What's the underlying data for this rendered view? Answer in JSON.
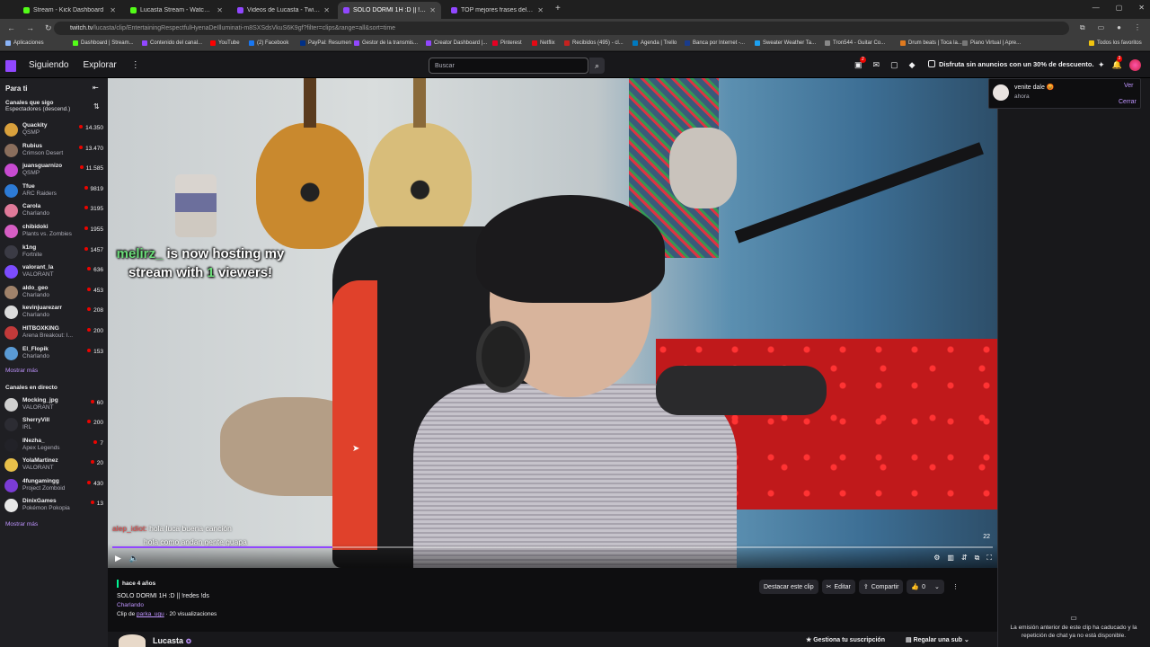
{
  "browser": {
    "tabs": [
      {
        "title": "Stream - Kick Dashboard",
        "color": "#53fc18",
        "active": false
      },
      {
        "title": "Lucasta Stream - Watch Live on",
        "color": "#53fc18",
        "active": false
      },
      {
        "title": "Videos de Lucasta - Twitch",
        "color": "#9147ff",
        "active": false
      },
      {
        "title": "SOLO DORMI 1H :D || !redes !ds",
        "color": "#9147ff",
        "active": true
      },
      {
        "title": "TOP mejores frases del anime",
        "color": "#9147ff",
        "active": false
      }
    ],
    "url_prefix": "twitch.tv",
    "url_rest": "/lucasta/clip/EntertainingRespectfulHyenaDeIlluminati-m8SXSdsVkuS6K9gf?filter=clips&range=all&sort=time",
    "bookmarks": [
      "Aplicaciones",
      "Dashboard | Stream...",
      "Contenido del canal...",
      "YouTube",
      "(2) Facebook",
      "PayPal: Resumen",
      "Gestor de la transmis...",
      "Creator Dashboard |...",
      "Pinterest",
      "Netflix",
      "Recibidos (495) - cl...",
      "Agenda | Trello",
      "Banca por Internet -...",
      "Sweater Weather Ta...",
      "Tron544 - Guitar Co...",
      "Drum beats | Toca la...",
      "Piano Virtual | Apre...",
      "Todos los favoritos"
    ]
  },
  "topnav": {
    "following": "Siguiendo",
    "explore": "Explorar",
    "search_placeholder": "Buscar",
    "notif_count": "2",
    "promo": "Disfruta sin anuncios con un 30% de descuento.",
    "bits_count": "3"
  },
  "sidebar": {
    "title": "Para ti",
    "followed_title": "Canales que sigo",
    "followed_sub": "Espectadores (descend.)",
    "followed": [
      {
        "name": "Quackity",
        "cat": "QSMP",
        "viewers": "14.350",
        "color": "#d9a03c"
      },
      {
        "name": "Rubius",
        "cat": "Crimson Desert",
        "viewers": "13.470",
        "color": "#8a6e5c"
      },
      {
        "name": "juansguarnizo",
        "cat": "QSMP",
        "viewers": "11.585",
        "color": "#c84bd1"
      },
      {
        "name": "Tfue",
        "cat": "ARC Raiders",
        "viewers": "9819",
        "color": "#2d7bd6"
      },
      {
        "name": "Carola",
        "cat": "Charlando",
        "viewers": "3195",
        "color": "#e07a9a"
      },
      {
        "name": "chibidoki",
        "cat": "Plants vs. Zombies",
        "viewers": "1955",
        "color": "#d65ec4"
      },
      {
        "name": "k1ng",
        "cat": "Fortnite",
        "viewers": "1457",
        "color": "#3b3b45"
      },
      {
        "name": "valorant_la",
        "cat": "VALORANT",
        "viewers": "636",
        "color": "#7c4cff"
      },
      {
        "name": "aldo_geo",
        "cat": "Charlando",
        "viewers": "453",
        "color": "#a0826a"
      },
      {
        "name": "kevinjuarezarr",
        "cat": "Charlando",
        "viewers": "208",
        "color": "#dcdcdc"
      },
      {
        "name": "HITBOXKING",
        "cat": "Arena Breakout: I...",
        "viewers": "200",
        "color": "#c23a3a"
      },
      {
        "name": "El_Flopik",
        "cat": "Charlando",
        "viewers": "153",
        "color": "#5a9bd6"
      }
    ],
    "more1": "Mostrar más",
    "live_title": "Canales en directo",
    "live": [
      {
        "name": "Mocking_jpg",
        "cat": "VALORANT",
        "viewers": "60",
        "color": "#d0d0d0"
      },
      {
        "name": "SherryVill",
        "cat": "IRL",
        "viewers": "200",
        "color": "#2c2c33"
      },
      {
        "name": "INezha_",
        "cat": "Apex Legends",
        "viewers": "7",
        "color": "#222228"
      },
      {
        "name": "YolaMartinez",
        "cat": "VALORANT",
        "viewers": "20",
        "color": "#e8c04a"
      },
      {
        "name": "4fungamingg",
        "cat": "Project Zomboid",
        "viewers": "430",
        "color": "#7b3cd6"
      },
      {
        "name": "DinixGames",
        "cat": "Pokémon Pokopia",
        "viewers": "13",
        "color": "#e8e8e8"
      }
    ],
    "more2": "Mostrar más"
  },
  "video": {
    "host_prefix": "melirz_",
    "host_mid": " is now hosting my stream with ",
    "host_num": "1",
    "host_end": " viewers!",
    "chat": [
      {
        "user": "alep_idiot:",
        "text": " hola luca buena canción"
      },
      {
        "user": "",
        "text": "hola como andan gente guapa"
      }
    ],
    "timecode": "22",
    "progress": 0.25
  },
  "clip": {
    "ago": "hace 4 años",
    "title": "SOLO DORMI 1H :D || !redes !ds",
    "category": "Charlando",
    "by_prefix": "Clip de ",
    "by_user": "parka_ugu",
    "views": " · 20 visualizaciones",
    "feature": "Destacar este clip",
    "edit": "Editar",
    "share": "Compartir",
    "likes": "0"
  },
  "streamer": {
    "name": "Lucasta",
    "manage_sub": "Gestiona tu suscripción",
    "gift_sub": "Regalar una sub"
  },
  "notification": {
    "text": "venite dale 😡",
    "time": "ahora",
    "view": "Ver",
    "close": "Cerrar"
  },
  "chat_panel": {
    "expired": "La emisión anterior de este clip ha caducado y la repetición de chat ya no está disponible."
  }
}
